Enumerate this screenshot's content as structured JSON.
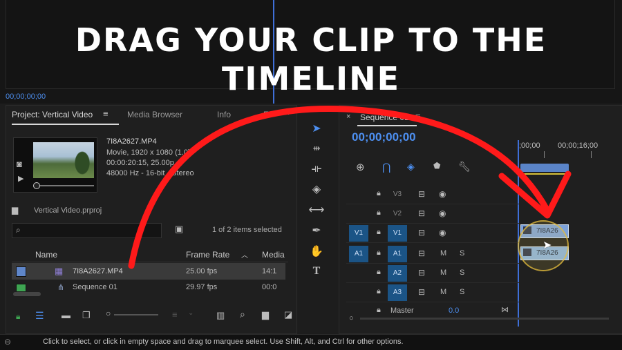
{
  "overlay": {
    "line1": "DRAG YOUR CLIP TO THE",
    "line2": "TIMELINE"
  },
  "program_monitor": {
    "timecode": "00;00;00;00"
  },
  "project_panel": {
    "tabs": [
      "Project: Vertical Video",
      "Media Browser",
      "Info",
      "E"
    ],
    "clip_name": "7I8A2627.MP4",
    "clip_meta": [
      "Movie, 1920 x 1080 (1.0)",
      "00:00:20:15, 25.00p",
      "48000 Hz - 16-bit - Stereo"
    ],
    "project_file": "Vertical Video.prproj",
    "search_placeholder": "",
    "item_count": "1 of 2 items selected",
    "columns": [
      "Name",
      "Frame Rate",
      "Media"
    ],
    "rows": [
      {
        "name": "7I8A2627.MP4",
        "fps": "25.00 fps",
        "media": "14:1",
        "color": "#5f86c9"
      },
      {
        "name": "Sequence 01",
        "fps": "29.97 fps",
        "media": "00:0",
        "color": "#3ea552"
      }
    ]
  },
  "sequence": {
    "tab": "Sequence 01",
    "timecode": "00;00;00;00",
    "ruler_labels": [
      ";00;00",
      "00;00;16;00"
    ],
    "tracks": [
      {
        "src": "",
        "name": "V3"
      },
      {
        "src": "",
        "name": "V2"
      },
      {
        "src": "V1",
        "name": "V1"
      },
      {
        "src": "A1",
        "name": "A1"
      },
      {
        "src": "",
        "name": "A2"
      },
      {
        "src": "",
        "name": "A3"
      }
    ],
    "master_label": "Master",
    "master_value": "0.0",
    "track_buttons": {
      "m": "M",
      "s": "S"
    },
    "clip_label_video": "7I8A26",
    "clip_label_audio": "7I8A26"
  },
  "colors": {
    "accent_blue": "#4d8ff0",
    "arrow_red": "#ff1a1a",
    "track_blue": "#1b5486"
  },
  "status": "Click to select, or click in empty space and drag to marquee select. Use Shift, Alt, and Ctrl for other options."
}
